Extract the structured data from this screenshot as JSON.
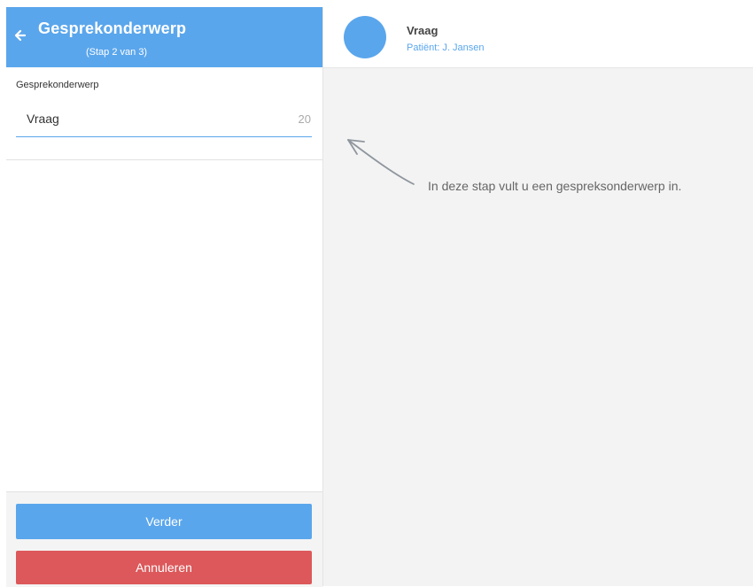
{
  "sidebar": {
    "header": {
      "title": "Gesprekonderwerp",
      "step": "(Stap 2 van 3)",
      "back_icon": "arrow-left-icon"
    },
    "field": {
      "label": "Gesprekonderwerp",
      "value": "Vraag",
      "char_count": "20"
    },
    "buttons": {
      "next": "Verder",
      "cancel": "Annuleren"
    }
  },
  "conversation": {
    "title": "Vraag",
    "patient": "Patiënt: J. Jansen"
  },
  "hint": {
    "text": "In deze stap vult u een gespreksonderwerp in."
  },
  "colors": {
    "primary": "#5aa6ec",
    "danger": "#dc585a",
    "panel_bg": "#f3f3f3"
  }
}
